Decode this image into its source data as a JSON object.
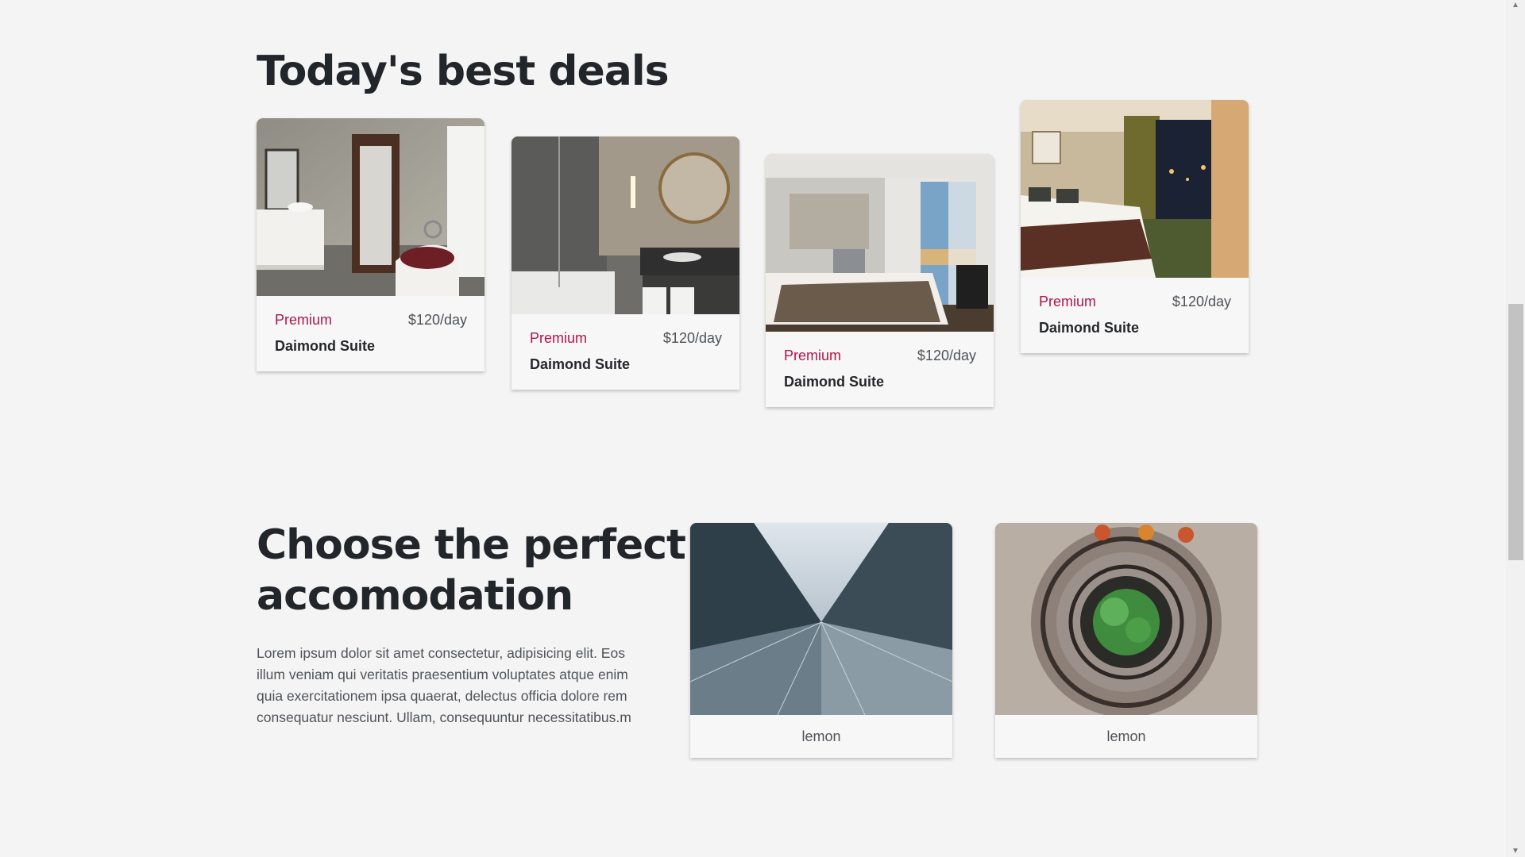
{
  "deals": {
    "title": "Today's best deals",
    "cards": [
      {
        "tier": "Premium",
        "price": "$120/day",
        "name": "Daimond Suite",
        "image": "bathroom-with-bathtub-photo"
      },
      {
        "tier": "Premium",
        "price": "$120/day",
        "name": "Daimond Suite",
        "image": "bathroom-with-round-mirror-photo"
      },
      {
        "tier": "Premium",
        "price": "$120/day",
        "name": "Daimond Suite",
        "image": "bedroom-with-balcony-photo"
      },
      {
        "tier": "Premium",
        "price": "$120/day",
        "name": "Daimond Suite",
        "image": "hotel-room-city-view-photo"
      }
    ]
  },
  "accommodation": {
    "title_line1": "Choose the perfect",
    "title_line2": "accomodation",
    "description": "Lorem ipsum dolor sit amet consectetur, adipisicing elit. Eos illum veniam qui veritatis praesentium voluptates atque enim quia exercitationem ipsa quaerat, delectus officia dolore rem consequatur nesciunt. Ullam, consequuntur necessitatibus.m",
    "cards": [
      {
        "label": "lemon",
        "image": "glass-skyscraper-photo"
      },
      {
        "label": "lemon",
        "image": "spiral-staircase-photo"
      }
    ]
  },
  "colors": {
    "background": "#f4f4f4",
    "accent": "#b0144a",
    "heading": "#22252a",
    "text": "#4f5358"
  },
  "icons": {
    "scroll_up": "arrow-up-icon",
    "scroll_down": "arrow-down-icon"
  }
}
